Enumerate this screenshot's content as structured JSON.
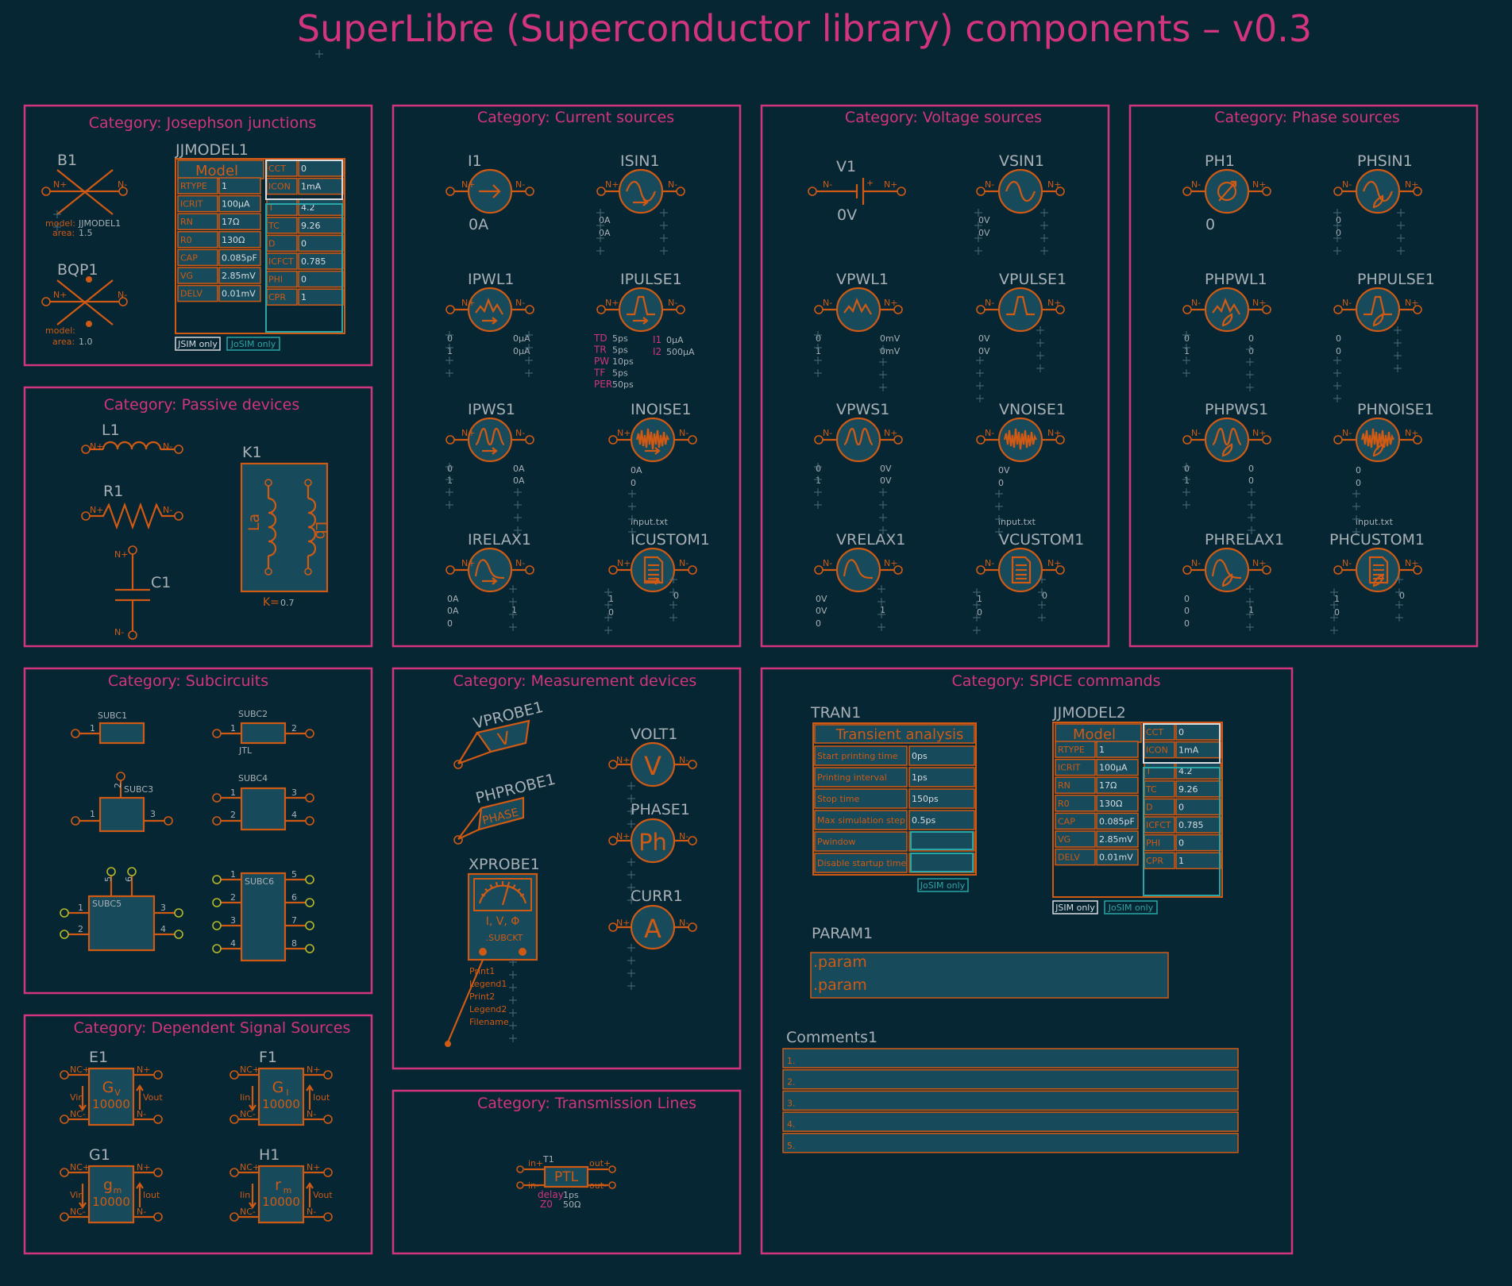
{
  "title": "SuperLibre (Superconductor library) components – v0.3",
  "colors": {
    "bg": "#062633",
    "magenta": "#d3347f",
    "orange": "#d05a14",
    "grey": "#a8b0b5",
    "cyan": "#2aa6a6",
    "white": "#d8dcdf",
    "boxfill": "#174a5b",
    "yellow": "#b6b82a"
  },
  "categories": {
    "jj": "Category: Josephson junctions",
    "current": "Category: Current sources",
    "voltage": "Category: Voltage sources",
    "phase": "Category: Phase sources",
    "passive": "Category: Passive devices",
    "subckt": "Category: Subcircuits",
    "meas": "Category: Measurement devices",
    "spice": "Category: SPICE commands",
    "dep": "Category: Dependent Signal Sources",
    "tline": "Category: Transmission Lines"
  },
  "jj": {
    "b1": "B1",
    "bqp1": "BQP1",
    "model_label": "model:",
    "area_label": "area:",
    "b1_model": "JJMODEL1",
    "b1_area": "1.5",
    "bqp1_area": "1.0",
    "jjmodel_name": "JJMODEL1"
  },
  "jjmodel": {
    "header": "Model",
    "left": [
      [
        "RTYPE",
        "1"
      ],
      [
        "ICRIT",
        "100µA"
      ],
      [
        "RN",
        "17Ω"
      ],
      [
        "R0",
        "130Ω"
      ],
      [
        "CAP",
        "0.085pF"
      ],
      [
        "VG",
        "2.85mV"
      ],
      [
        "DELV",
        "0.01mV"
      ]
    ],
    "right": [
      [
        "CCT",
        "0"
      ],
      [
        "ICON",
        "1mA"
      ],
      [
        "T",
        "4.2"
      ],
      [
        "TC",
        "9.26"
      ],
      [
        "D",
        "0"
      ],
      [
        "ICFCT",
        "0.785"
      ],
      [
        "PHI",
        "0"
      ],
      [
        "CPR",
        "1"
      ]
    ],
    "jsim_only": "JSIM only",
    "josim_only": "JoSIM only"
  },
  "pins": {
    "np": "N+",
    "nm": "N-",
    "nc_p": "NC+",
    "nc_m": "NC-",
    "vin": "Vin",
    "vout": "Vout",
    "iin": "Iin",
    "iout": "Iout",
    "in_p": "in+",
    "in_m": "in-",
    "out_p": "out+",
    "out_m": "out-"
  },
  "current": {
    "i1": "I1",
    "i1_val": "0A",
    "isin": "ISIN1",
    "isin_v1": "0A",
    "isin_v2": "0A",
    "ipwl": "IPWL1",
    "ipwl_l1": "0",
    "ipwl_l2": "1",
    "ipwl_r1": "0µA",
    "ipwl_r2": "0µA",
    "ipulse": "IPULSE1",
    "pulse_keys": [
      "TD",
      "TR",
      "PW",
      "TF",
      "PER"
    ],
    "pulse_vals": [
      "5ps",
      "5ps",
      "10ps",
      "5ps",
      "50ps"
    ],
    "ipulse_i1k": "I1",
    "ipulse_i1v": "0µA",
    "ipulse_i2k": "I2",
    "ipulse_i2v": "500µA",
    "ipws": "IPWS1",
    "ipws_l1": "0",
    "ipws_l2": "1",
    "ipws_r1": "0A",
    "ipws_r2": "0A",
    "inoise": "INOISE1",
    "inoise_v1": "0A",
    "inoise_v2": "0",
    "irelax": "IRELAX1",
    "irelax_v1": "0A",
    "irelax_v2": "0A",
    "irelax_v3": "0",
    "irelax_r": "1",
    "icustom": "ICUSTOM1",
    "file": "input.txt",
    "icustom_l": "1",
    "icustom_l2": "0",
    "icustom_r": "0"
  },
  "voltage": {
    "v1": "V1",
    "v1_val": "0V",
    "vsin": "VSIN1",
    "vsin_v1": "0V",
    "vsin_v2": "0V",
    "vpwl": "VPWL1",
    "vpwl_l1": "0",
    "vpwl_l2": "1",
    "vpwl_r1": "0mV",
    "vpwl_r2": "0mV",
    "vpulse": "VPULSE1",
    "vpulse_v1": "0V",
    "vpulse_v2": "0V",
    "vpws": "VPWS1",
    "vpws_l1": "0",
    "vpws_l2": "1",
    "vpws_r1": "0V",
    "vpws_r2": "0V",
    "vnoise": "VNOISE1",
    "vnoise_v1": "0V",
    "vnoise_v2": "0",
    "vrelax": "VRELAX1",
    "vrelax_v1": "0V",
    "vrelax_v2": "0V",
    "vrelax_v3": "0",
    "vrelax_r": "1",
    "vcustom": "VCUSTOM1",
    "file": "input.txt",
    "vcustom_l": "1",
    "vcustom_l2": "0",
    "vcustom_r": "0"
  },
  "phase": {
    "ph1": "PH1",
    "ph1_val": "0",
    "phsin": "PHSIN1",
    "phsin_v1": "0",
    "phsin_v2": "0",
    "phpwl": "PHPWL1",
    "phpwl_l1": "0",
    "phpwl_l2": "1",
    "phpwl_r1": "0",
    "phpwl_r2": "0",
    "phpulse": "PHPULSE1",
    "phpulse_v1": "0",
    "phpulse_v2": "0",
    "phpws": "PHPWS1",
    "phpws_l1": "0",
    "phpws_l2": "1",
    "phpws_r1": "0",
    "phpws_r2": "0",
    "phnoise": "PHNOISE1",
    "phnoise_v1": "0",
    "phnoise_v2": "0",
    "phrelax": "PHRELAX1",
    "phrelax_v1": "0",
    "phrelax_v2": "0",
    "phrelax_v3": "0",
    "phrelax_r": "1",
    "phcustom": "PHCUSTOM1",
    "file": "input.txt",
    "phcustom_l": "1",
    "phcustom_l2": "0",
    "phcustom_r": "0"
  },
  "passive": {
    "l1": "L1",
    "r1": "R1",
    "c1": "C1",
    "k1": "K1",
    "la": "La",
    "lb": "Lb",
    "k_label": "K=",
    "k_val": "0.7"
  },
  "subckt": {
    "s1": "SUBC1",
    "s2": "SUBC2",
    "s2_sub": "JTL",
    "s3": "SUBC3",
    "s4": "SUBC4",
    "s5": "SUBC5",
    "s6": "SUBC6",
    "p1": "1",
    "p2": "2",
    "p3": "3",
    "p4": "4",
    "p5": "5",
    "p6": "6",
    "p7": "7",
    "p8": "8"
  },
  "meas": {
    "vprobe": "VPROBE1",
    "vprobe_sym": "V",
    "phprobe": "PHPROBE1",
    "phprobe_sym": "PHASE",
    "xprobe": "XPROBE1",
    "xprobe_sym": "I, V, Φ",
    "xprobe_sub": ".SUBCKT",
    "xprobe_params": [
      "Print1",
      "Legend1",
      "Print2",
      "Legend2",
      "Filename"
    ],
    "volt": "VOLT1",
    "volt_sym": "V",
    "phase": "PHASE1",
    "phase_sym": "Ph",
    "curr": "CURR1",
    "curr_sym": "A"
  },
  "spice": {
    "tran": "TRAN1",
    "tran_header": "Transient analysis",
    "tran_rows": [
      [
        "Start printing time",
        "0ps"
      ],
      [
        "Printing interval",
        "1ps"
      ],
      [
        "Stop time",
        "150ps"
      ],
      [
        "Max simulation step",
        "0.5ps"
      ],
      [
        "Pwindow",
        ""
      ],
      [
        "Disable startup time",
        ""
      ]
    ],
    "jjmodel2": "JJMODEL2",
    "param": "PARAM1",
    "param_lines": [
      ".param",
      ".param"
    ],
    "comments": "Comments1",
    "comment_lines": [
      "1.",
      "2.",
      "3.",
      "4.",
      "5."
    ]
  },
  "dep": {
    "e1": "E1",
    "f1": "F1",
    "g1": "G1",
    "h1": "H1",
    "gv": "G",
    "gv_sub": "V",
    "gi": "G",
    "gi_sub": "I",
    "gm": "g",
    "gm_sub": "m",
    "rm": "r",
    "rm_sub": "m",
    "gain": "10000"
  },
  "tline": {
    "t1": "T1",
    "sym": "PTL",
    "delay_k": "delay",
    "delay_v": "1ps",
    "z0_k": "Z0",
    "z0_v": "50Ω"
  }
}
